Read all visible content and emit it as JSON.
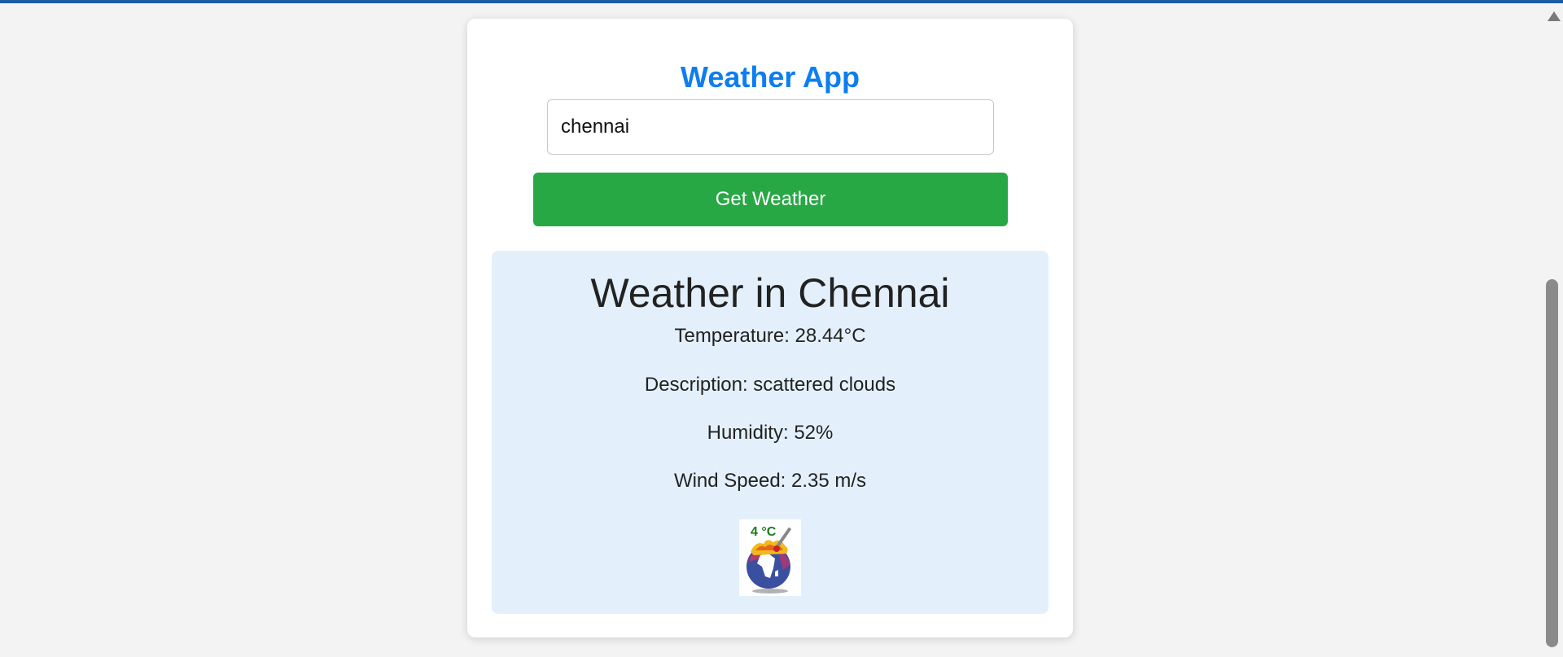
{
  "app": {
    "title": "Weather App"
  },
  "search": {
    "value": "chennai"
  },
  "button": {
    "label": "Get Weather"
  },
  "result": {
    "title": "Weather in Chennai",
    "temperature": "Temperature: 28.44°C",
    "description": "Description: scattered clouds",
    "humidity": "Humidity: 52%",
    "wind": "Wind Speed: 2.35 m/s",
    "icon_name": "global-warming-globe-icon",
    "icon_text": "4 °C"
  },
  "colors": {
    "title": "#0d7ef0",
    "button": "#28a745",
    "result_bg": "#e3f0fb",
    "topbar": "#1d5aa6"
  }
}
